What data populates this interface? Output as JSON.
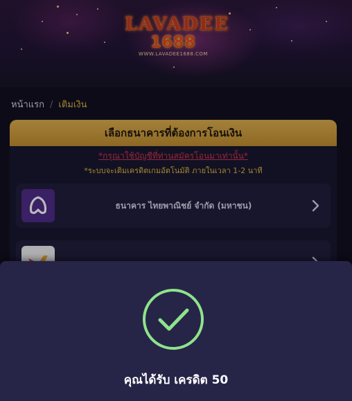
{
  "banner": {
    "logo_top": "LAVADEE",
    "logo_number": "1688",
    "logo_url": "WWW.LAVADEE1688.COM"
  },
  "breadcrumb": {
    "home": "หน้าแรก",
    "separator": "/",
    "current": "เติมเงิน"
  },
  "deposit_card": {
    "title": "เลือกธนาคารที่ต้องการโอนเงิน",
    "notice_link": "*กรุณาใช้บัญชีที่ท่านสมัครโอนมาเท่านั้น*",
    "notice_auto": "*ระบบจะเติมเครดิตเกมอัตโนมัติ ภายในเวลา 1-2 นาที",
    "banks": [
      {
        "name": "ธนาคาร ไทยพาณิชย์ จำกัด (มหาชน)",
        "icon": "scb-bank-icon",
        "color": "#4e2a84"
      },
      {
        "name": "",
        "icon": "truemoney-wallet-icon",
        "color": "#f0f0f0"
      }
    ]
  },
  "success_modal": {
    "icon": "checkmark-circle-icon",
    "message": "คุณได้รับ เครดิต 50"
  },
  "colors": {
    "accent_gold": "#e0b73d",
    "card_header": "#d4a23c",
    "notice_red": "#d2324a",
    "sheet_bg": "#262548",
    "check_green": "#8fe38a"
  }
}
